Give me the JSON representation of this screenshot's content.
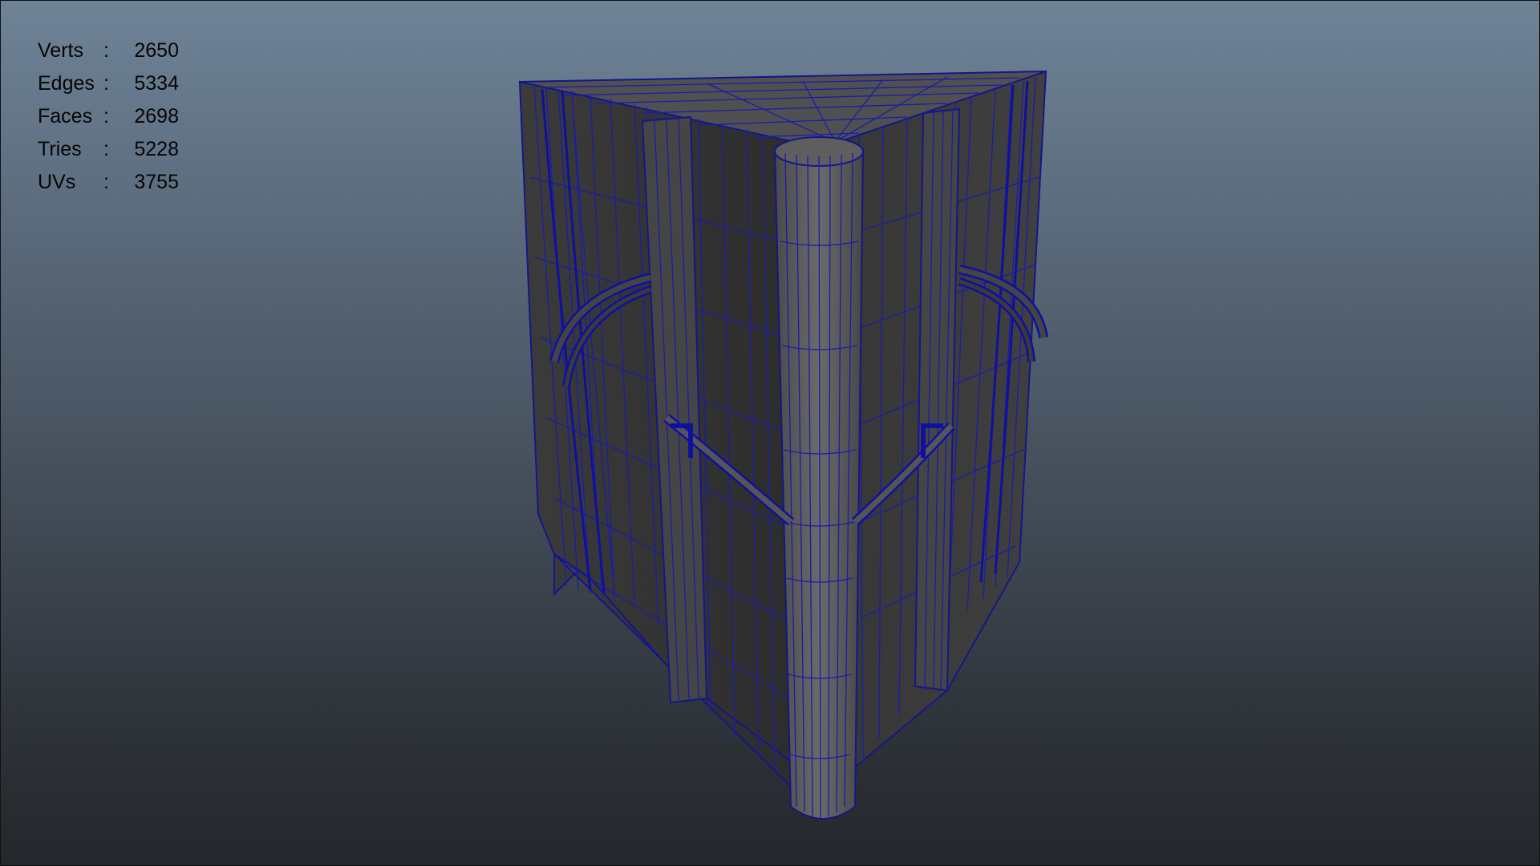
{
  "stats": [
    {
      "label": "Verts",
      "sep": ":",
      "value": "2650"
    },
    {
      "label": "Edges",
      "sep": ":",
      "value": "5334"
    },
    {
      "label": "Faces",
      "sep": ":",
      "value": "2698"
    },
    {
      "label": "Tries",
      "sep": ":",
      "value": "5228"
    },
    {
      "label": "UVs",
      "sep": ":",
      "value": "3755"
    }
  ],
  "colors": {
    "wireframe": "#1a1da8",
    "mesh_fill": "#3a3a3a",
    "background_top": "#6f8397",
    "background_bottom": "#24272b"
  }
}
